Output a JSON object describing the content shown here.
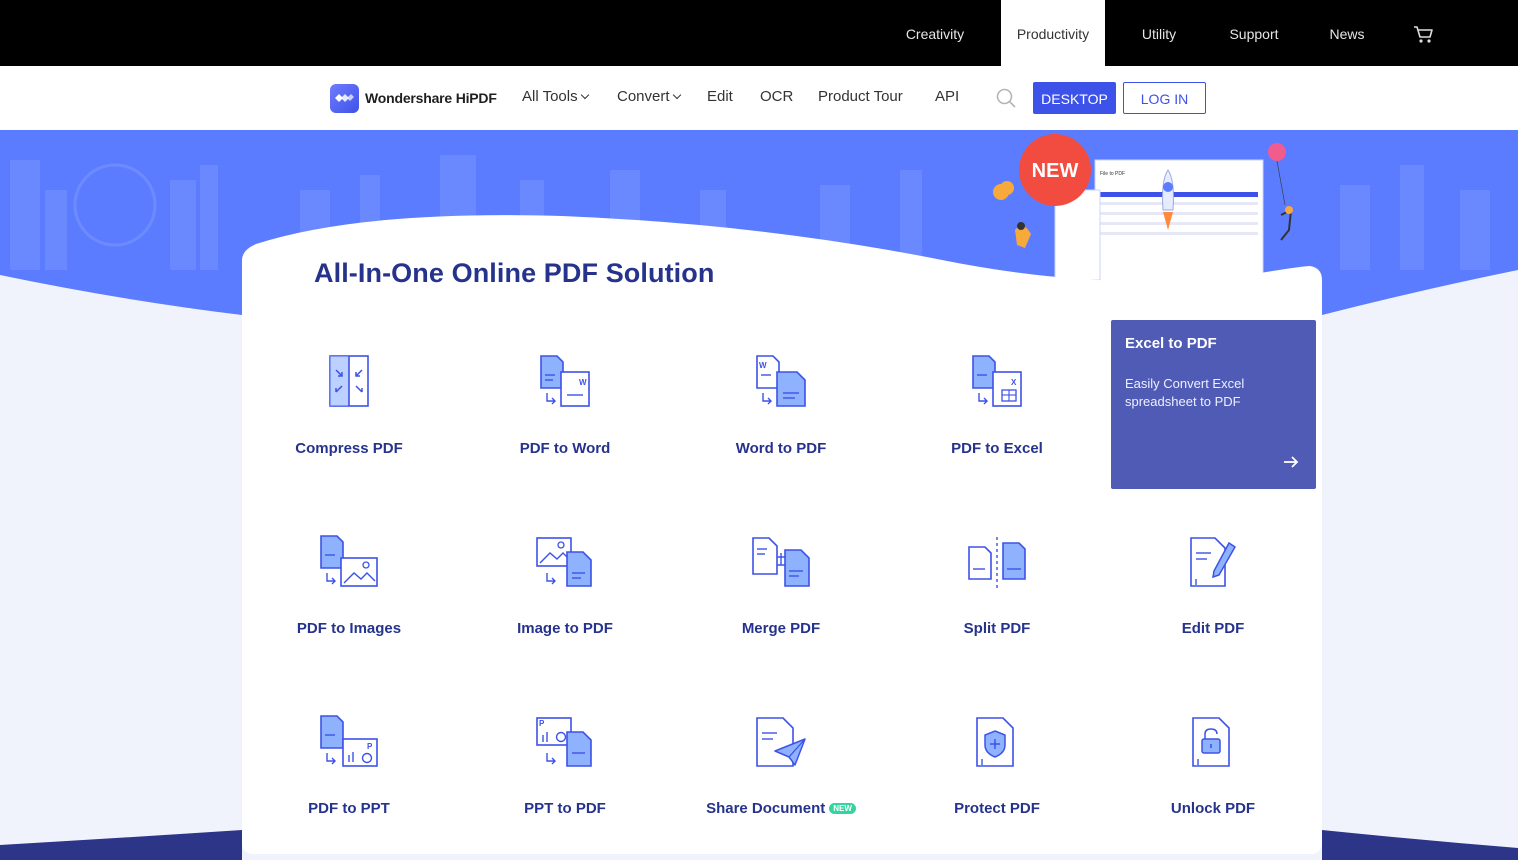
{
  "topbar": {
    "items": [
      {
        "label": "Creativity",
        "active": false
      },
      {
        "label": "Productivity",
        "active": true
      },
      {
        "label": "Utility",
        "active": false
      },
      {
        "label": "Support",
        "active": false
      },
      {
        "label": "News",
        "active": false
      }
    ],
    "cart_icon": "shopping-cart-icon"
  },
  "nav": {
    "brand": "Wondershare HiPDF",
    "links": [
      "All Tools",
      "Convert",
      "Edit",
      "OCR",
      "Product Tour",
      "API"
    ],
    "search_icon": "search-icon",
    "desktop_label": "DESKTOP",
    "login_label": "LOG IN"
  },
  "hero": {
    "badge": "NEW",
    "window_title": "File to PDF"
  },
  "main": {
    "title": "All-In-One Online PDF Solution",
    "promo": {
      "title": "Excel to PDF",
      "desc": "Easily Convert Excel spreadsheet to PDF",
      "icon": "arrow-right-icon"
    },
    "tools": [
      {
        "label": "Compress PDF",
        "icon": "compress-pdf-icon"
      },
      {
        "label": "PDF to Word",
        "icon": "pdf-to-word-icon"
      },
      {
        "label": "Word to PDF",
        "icon": "word-to-pdf-icon"
      },
      {
        "label": "PDF to Excel",
        "icon": "pdf-to-excel-icon"
      },
      {
        "label": "PDF to Images",
        "icon": "pdf-to-images-icon"
      },
      {
        "label": "Image to PDF",
        "icon": "image-to-pdf-icon"
      },
      {
        "label": "Merge PDF",
        "icon": "merge-pdf-icon"
      },
      {
        "label": "Split PDF",
        "icon": "split-pdf-icon"
      },
      {
        "label": "Edit PDF",
        "icon": "edit-pdf-icon"
      },
      {
        "label": "PDF to PPT",
        "icon": "pdf-to-ppt-icon"
      },
      {
        "label": "PPT to PDF",
        "icon": "ppt-to-pdf-icon"
      },
      {
        "label": "Share Document",
        "icon": "share-document-icon",
        "badge": "NEW"
      },
      {
        "label": "Protect PDF",
        "icon": "protect-pdf-icon"
      },
      {
        "label": "Unlock PDF",
        "icon": "unlock-pdf-icon"
      }
    ]
  },
  "colors": {
    "accent": "#3d52e8",
    "title": "#26338c",
    "hero_blue": "#5b7cff",
    "promo": "#4f5bb5",
    "icon_fill": "#8fb2ff",
    "icon_stroke": "#3d52e8"
  }
}
